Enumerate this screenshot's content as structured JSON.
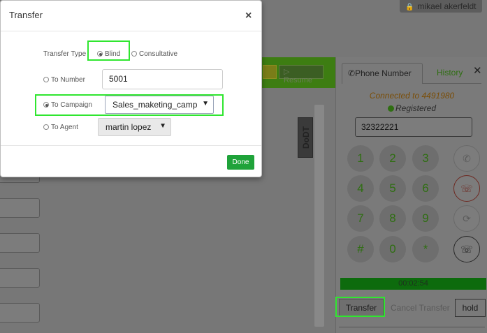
{
  "background": {
    "user_name": "mikael akerfeldt",
    "resume_label": "Resume",
    "side_label": "DoDT"
  },
  "phone_panel": {
    "tabs": [
      {
        "label": "Phone Number",
        "active": true
      },
      {
        "label": "History",
        "active": false
      }
    ],
    "connected_text": "Connected to 4491980",
    "status_text": "Registered",
    "phone_input": "32322221",
    "keys": [
      "1",
      "2",
      "3",
      "4",
      "5",
      "6",
      "7",
      "8",
      "9",
      "#",
      "0",
      "*"
    ],
    "timer": "00:02:54",
    "transfer_label": "Transfer",
    "cancel_transfer_label": "Cancel Transfer",
    "hold_label": "hold"
  },
  "modal": {
    "title": "Transfer",
    "close_symbol": "×",
    "transfer_type_label": "Transfer Type",
    "blind_label": "Blind",
    "consultative_label": "Consultative",
    "to_number_label": "To Number",
    "to_number_value": "5001",
    "to_campaign_label": "To Campaign",
    "campaign_selected": "Sales_maketing_camp",
    "to_agent_label": "To Agent",
    "agent_selected": "martin lopez",
    "done_label": "Done",
    "transfer_type_selected": "Blind",
    "destination_selected": "To Campaign"
  },
  "colors": {
    "highlight": "#2fe62f",
    "done_button": "#1fa33a",
    "timer_bar": "#0d6b0d"
  }
}
